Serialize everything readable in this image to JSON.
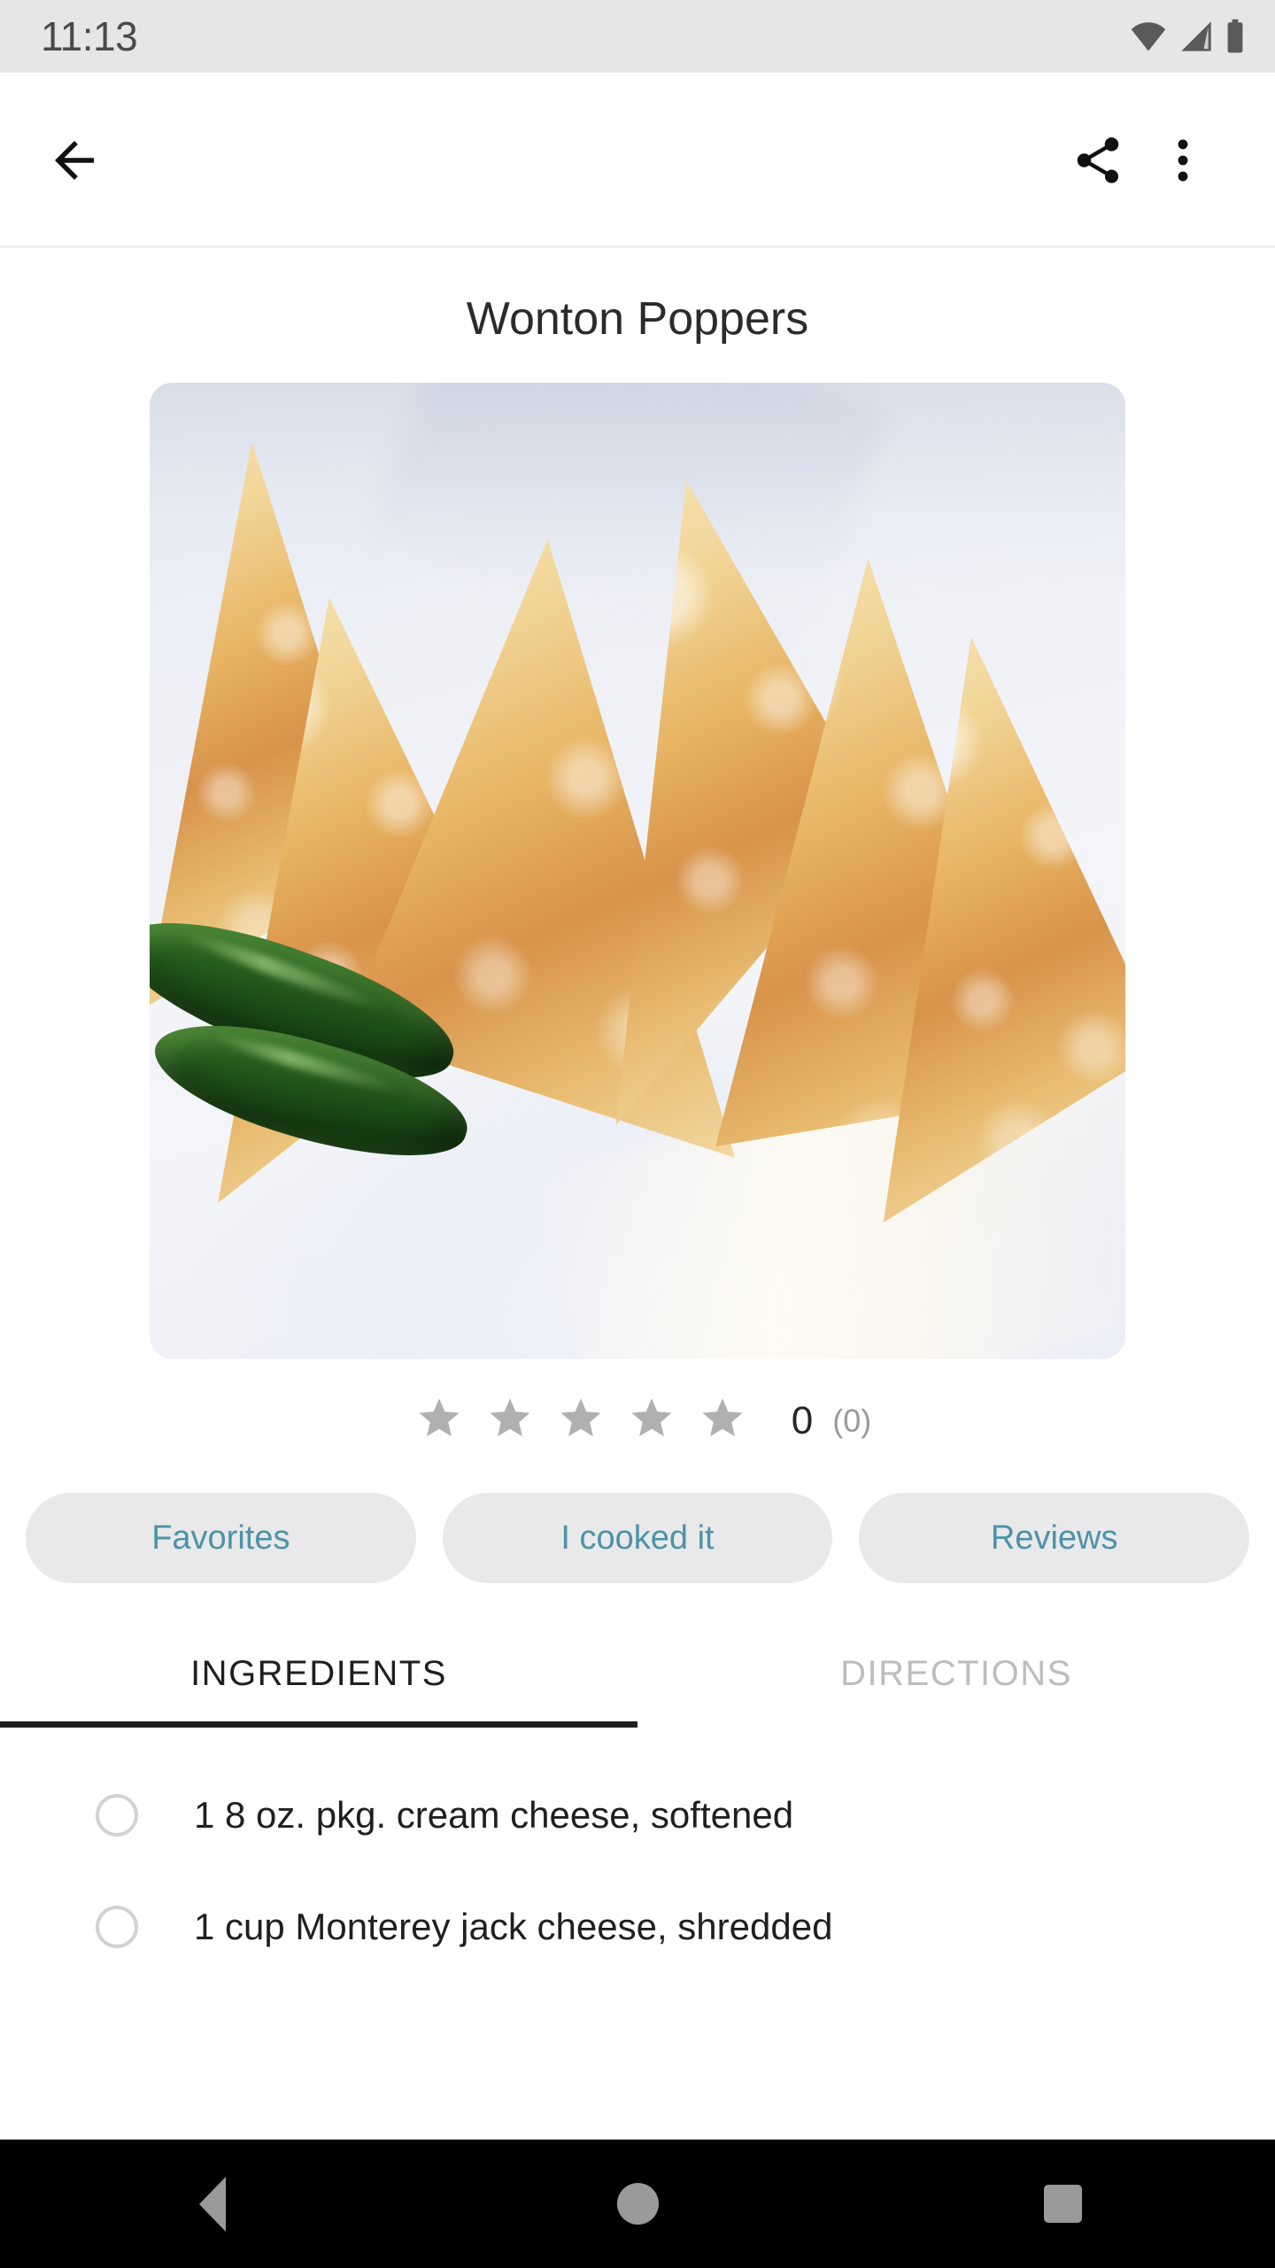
{
  "status_bar": {
    "time": "11:13",
    "icons": [
      "wifi-icon",
      "cellular-signal-icon",
      "battery-icon"
    ]
  },
  "app_bar": {
    "back_icon": "arrow-back-icon",
    "share_icon": "share-icon",
    "overflow_icon": "more-vert-icon"
  },
  "recipe": {
    "title": "Wonton Poppers",
    "photo_alt": "fried wonton triangles with jalapeno peppers on a white plate"
  },
  "rating": {
    "stars_total": 5,
    "stars_filled": 0,
    "value": "0",
    "count": "(0)",
    "star_color": "#b0b0b0"
  },
  "actions": [
    {
      "label": "Favorites",
      "name": "favorites-button"
    },
    {
      "label": "I cooked it",
      "name": "i-cooked-it-button"
    },
    {
      "label": "Reviews",
      "name": "reviews-button"
    }
  ],
  "tabs": [
    {
      "label": "INGREDIENTS",
      "active": true
    },
    {
      "label": "DIRECTIONS",
      "active": false
    }
  ],
  "ingredients": [
    {
      "text": "1 8 oz. pkg. cream cheese, softened",
      "checked": false
    },
    {
      "text": "1 cup Monterey jack cheese, shredded",
      "checked": false
    }
  ],
  "nav_bar": {
    "back": "nav-back-icon",
    "home": "nav-home-icon",
    "recents": "nav-recents-icon"
  },
  "colors": {
    "accent_teal": "#4c93a8",
    "pill_bg": "#e9e9e9",
    "status_bg": "#e6e6e6",
    "tab_active": "#1f1f1f",
    "tab_inactive": "#bdbdbd"
  }
}
